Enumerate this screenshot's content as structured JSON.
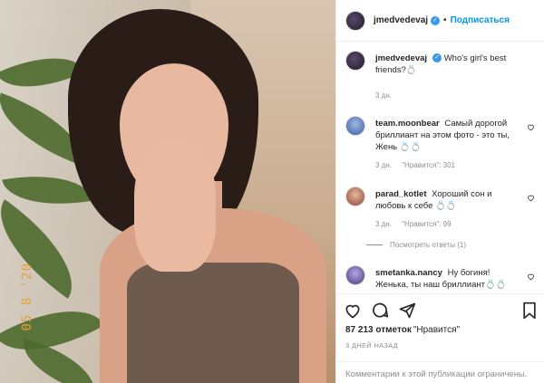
{
  "post": {
    "author": "jmedvedevaj",
    "follow_label": "Подписаться",
    "dot": "•",
    "photo_date_stamp": "05 8 '20"
  },
  "caption": {
    "author": "jmedvedevaj",
    "text": "Who's girl's best friends?💍",
    "time": "3 дн."
  },
  "comments": [
    {
      "author": "team.moonbear",
      "text": "Самый дорогой бриллиант на этом фото - это ты, Жень 💍💍",
      "time": "3 дн.",
      "likes": "\"Нравится\": 301"
    },
    {
      "author": "parad_kotlet",
      "text": "Хороший сон и любовь к себе 💍💍",
      "time": "3 дн.",
      "likes": "\"Нравится\": 99",
      "replies": "Посмотреть ответы (1)"
    },
    {
      "author": "smetanka.nancy",
      "text": "Ну богиня! Женька, ты наш бриллиант💍💍"
    }
  ],
  "actions": {
    "likes_count": "87 213 отметок",
    "likes_label": "\"Нравится\"",
    "date": "3 ДНЕЙ НАЗАД",
    "comments_closed": "Комментарии к этой публикации ограничены."
  },
  "colors": {
    "accent": "#0095f6",
    "muted": "#8e8e8e",
    "text": "#262626",
    "photo_stamp": "#e7a03a"
  },
  "icons": [
    "heart-icon",
    "comment-icon",
    "share-icon",
    "bookmark-icon",
    "verified-icon"
  ]
}
